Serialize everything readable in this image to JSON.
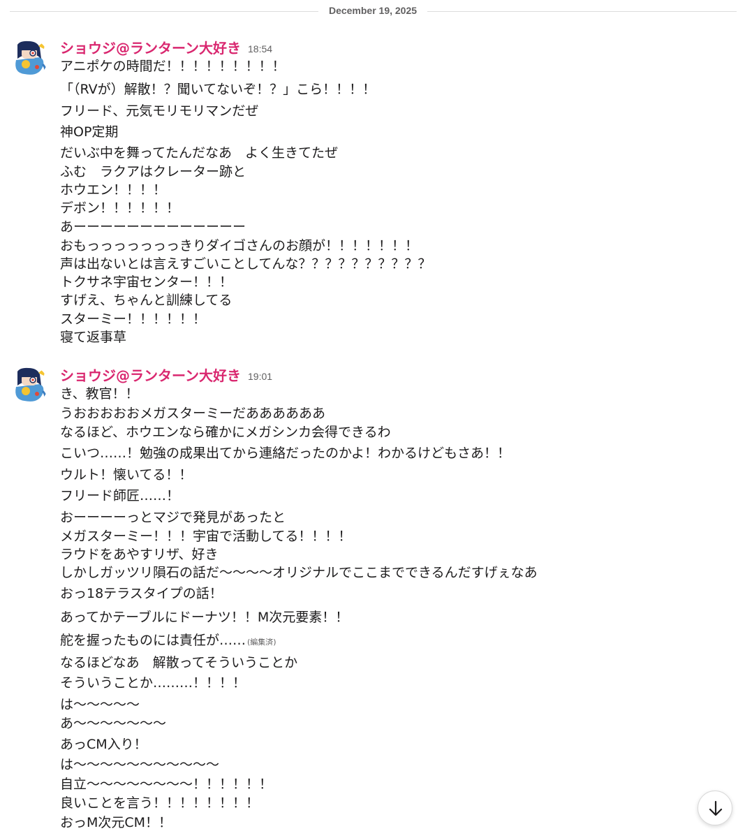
{
  "date_divider": {
    "label": "December 19, 2025"
  },
  "messages": [
    {
      "sender": "ショウジ@ランターン大好き",
      "time": "18:54",
      "lines": [
        "アニポケの時間だ！！！！！！！！！",
        "「（RVが）解散！？聞いてないぞ！？」こら！！！！",
        "フリード、元気モリモリマンだぜ",
        "神OP定期",
        "だいぶ中を舞ってたんだなあ　よく生きてたぜ",
        "ふむ　ラクアはクレーター跡と",
        "ホウエン！！！！",
        "デボン！！！！！！",
        "あーーーーーーーーーーーーー",
        "おもっっっっっっっきりダイゴさんのお顔が！！！！！！！",
        "声は出ないとは言えすごいことしてんな？？？？？？？？？？",
        "トクサネ宇宙センター！！！",
        "すげえ、ちゃんと訓練してる",
        "スターミー！！！！！！",
        "寝て返事草"
      ]
    },
    {
      "sender": "ショウジ@ランターン大好き",
      "time": "19:01",
      "lines": [
        "き、教官！！",
        "うおおおおおメガスターミーだああああああ",
        "なるほど、ホウエンなら確かにメガシンカ会得できるわ",
        "こいつ……！勉強の成果出てから連絡だったのかよ！わかるけどもさあ！！",
        "ウルト！懐いてる！！",
        "フリード師匠……！",
        "おーーーーっとマジで発見があったと",
        "メガスターミー！！！宇宙で活動してる！！！！",
        "ラウドをあやすリザ、好き",
        "しかしガッツリ隕石の話だ〜〜〜〜オリジナルでここまでできるんだすげぇなあ",
        "おっ18テラスタイプの話！",
        "あってかテーブルにドーナツ！！M次元要素！！",
        "舵を握ったものには責任が……",
        "なるほどなあ　解散ってそういうことか",
        "そういうことか………！！！！",
        "は〜〜〜〜〜",
        "あ〜〜〜〜〜〜〜",
        "あっCM入り！",
        "は〜〜〜〜〜〜〜〜〜〜〜",
        "自立〜〜〜〜〜〜〜〜！！！！！！",
        "良いことを言う！！！！！！！！",
        "おっM次元CM！！"
      ],
      "edited_label": "(編集済)"
    }
  ],
  "icons": {
    "avatar": "avatar-illustration",
    "scroll_button": "arrow-down-icon"
  },
  "colors": {
    "sender": "#d9276f",
    "text": "#1d1c1d",
    "meta": "#616061",
    "divider": "#dddddd"
  }
}
